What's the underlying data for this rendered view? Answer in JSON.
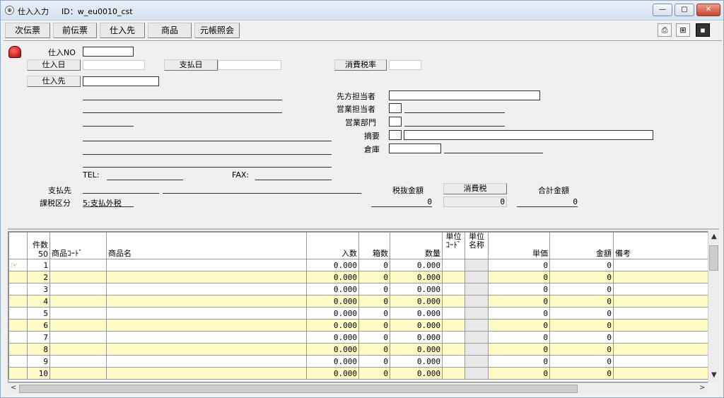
{
  "window": {
    "title": "仕入入力",
    "id_text": "ID：w_eu0010_cst",
    "minimize": "—",
    "maximize": "▢",
    "close": "✕"
  },
  "toolbar": {
    "buttons": [
      "次伝票",
      "前伝票",
      "仕入先",
      "商品",
      "元帳照会"
    ]
  },
  "form": {
    "shiire_no_label": "仕入NO",
    "shiire_date_btn": "仕入日",
    "shiharai_date_btn": "支払日",
    "tax_rate_btn": "消費税率",
    "shiiresaki_btn": "仕入先",
    "senpo_tanto_label": "先方担当者",
    "eigyo_tanto_label": "営業担当者",
    "eigyo_bumon_label": "営業部門",
    "tekiyo_label": "摘要",
    "soko_label": "倉庫",
    "tel_label": "TEL:",
    "fax_label": "FAX:",
    "shiharaisaki_label": "支払先",
    "kazei_label": "課税区分",
    "kazei_value": "5:支払外税",
    "zeinuki_label": "税抜金額",
    "shohizei_btn": "消費税",
    "gokei_label": "合計金額",
    "zeinuki_value": "0",
    "shohizei_value": "0",
    "gokei_value": "0"
  },
  "grid": {
    "count_label": "件数",
    "count_value": "50",
    "headers": {
      "code": "商品ｺｰﾄﾞ",
      "name": "商品名",
      "irisu": "入数",
      "hakosu": "箱数",
      "suryo": "数量",
      "tani_code": "単位ｺｰﾄﾞ",
      "tani_name": "単位名称",
      "tanka": "単価",
      "kingaku": "金額",
      "biko": "備考"
    },
    "rows": [
      {
        "no": "1",
        "irisu": "0.000",
        "hakosu": "0",
        "suryo": "0.000",
        "tanka": "0",
        "kingaku": "0"
      },
      {
        "no": "2",
        "irisu": "0.000",
        "hakosu": "0",
        "suryo": "0.000",
        "tanka": "0",
        "kingaku": "0"
      },
      {
        "no": "3",
        "irisu": "0.000",
        "hakosu": "0",
        "suryo": "0.000",
        "tanka": "0",
        "kingaku": "0"
      },
      {
        "no": "4",
        "irisu": "0.000",
        "hakosu": "0",
        "suryo": "0.000",
        "tanka": "0",
        "kingaku": "0"
      },
      {
        "no": "5",
        "irisu": "0.000",
        "hakosu": "0",
        "suryo": "0.000",
        "tanka": "0",
        "kingaku": "0"
      },
      {
        "no": "6",
        "irisu": "0.000",
        "hakosu": "0",
        "suryo": "0.000",
        "tanka": "0",
        "kingaku": "0"
      },
      {
        "no": "7",
        "irisu": "0.000",
        "hakosu": "0",
        "suryo": "0.000",
        "tanka": "0",
        "kingaku": "0"
      },
      {
        "no": "8",
        "irisu": "0.000",
        "hakosu": "0",
        "suryo": "0.000",
        "tanka": "0",
        "kingaku": "0"
      },
      {
        "no": "9",
        "irisu": "0.000",
        "hakosu": "0",
        "suryo": "0.000",
        "tanka": "0",
        "kingaku": "0"
      },
      {
        "no": "10",
        "irisu": "0.000",
        "hakosu": "0",
        "suryo": "0.000",
        "tanka": "0",
        "kingaku": "0"
      }
    ]
  },
  "icons": {
    "pointer": "☞",
    "scroll_up": "▲",
    "scroll_down": "▼",
    "scroll_left": "<",
    "scroll_right": ">"
  },
  "colors": {
    "row_alt": "#fdfac6",
    "close_btn": "#c7432d"
  }
}
